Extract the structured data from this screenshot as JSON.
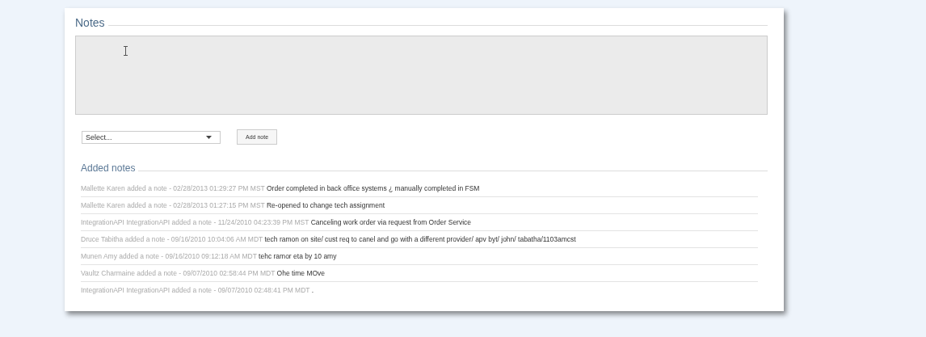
{
  "title": "Notes",
  "type_select": {
    "value": "Select..."
  },
  "add_button": "Add note",
  "added_notes": {
    "title": "Added notes",
    "items": [
      {
        "meta": "Mallette Karen added a note - 02/28/2013 01:29:27 PM MST",
        "text": "Order completed in back office systems ¿ manually completed in FSM"
      },
      {
        "meta": "Mallette Karen added a note - 02/28/2013 01:27:15 PM MST",
        "text": "Re-opened to change tech assignment"
      },
      {
        "meta": "IntegrationAPI IntegrationAPI added a note - 11/24/2010 04:23:39 PM MST",
        "text": "Canceling work order via request from Order Service"
      },
      {
        "meta": "Druce Tabitha added a note - 09/16/2010 10:04:06 AM MDT",
        "text": "tech ramon on site/ cust req to canel and go with a different provider/ apv byt/ john/ tabatha/1103amcst"
      },
      {
        "meta": "Munen Amy added a note - 09/16/2010 09:12:18 AM MDT",
        "text": "tehc ramor eta by 10 amy"
      },
      {
        "meta": "Vaultz Charmaine added a note - 09/07/2010 02:58:44 PM MDT",
        "text": "Ohe time MOve"
      },
      {
        "meta": "IntegrationAPI IntegrationAPI added a note - 09/07/2010 02:48:41 PM MDT",
        "text": "."
      }
    ]
  }
}
